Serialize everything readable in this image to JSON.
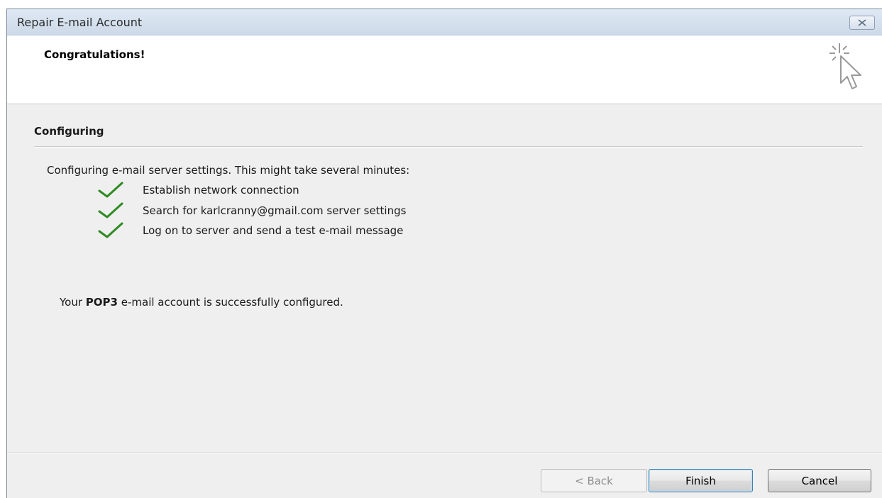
{
  "window": {
    "title": "Repair E-mail Account",
    "close_icon": "close-icon"
  },
  "header": {
    "title": "Congratulations!",
    "icon": "sparkle-cursor-icon"
  },
  "section": {
    "title": "Configuring",
    "intro": "Configuring e-mail server settings. This might take several minutes:"
  },
  "steps": [
    {
      "label": "Establish network connection",
      "status": "done",
      "icon": "check-icon"
    },
    {
      "label": "Search for karlcranny@gmail.com server settings",
      "status": "done",
      "icon": "check-icon"
    },
    {
      "label": "Log on to server and send a test e-mail message",
      "status": "done",
      "icon": "check-icon"
    }
  ],
  "result": {
    "prefix": "Your ",
    "account_type": "POP3",
    "suffix": " e-mail account is successfully configured."
  },
  "buttons": {
    "back": "< Back",
    "finish": "Finish",
    "cancel": "Cancel"
  },
  "colors": {
    "check": "#2e8b22",
    "dialog_bg": "#efefef",
    "titlebar": "#d6e1ee"
  }
}
